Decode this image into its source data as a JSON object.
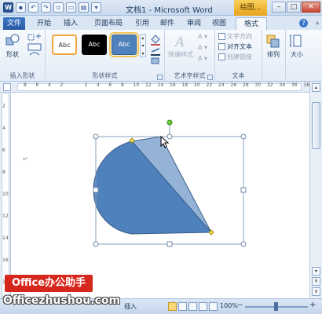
{
  "app": {
    "window_title": "文档1 - Microsoft Word",
    "context_tab_title": "绘图...",
    "window_buttons": {
      "minimize": "–",
      "maximize": "□",
      "close": "✕"
    }
  },
  "tabs": [
    "文件",
    "开始",
    "插入",
    "页面布局",
    "引用",
    "邮件",
    "审阅",
    "视图",
    "格式"
  ],
  "ribbon": {
    "groups": {
      "insert_shape": {
        "label": "插入形状",
        "shape_button": "形状"
      },
      "shape_styles": {
        "label": "形状样式",
        "samples": [
          "Abc",
          "Abc",
          "Abc"
        ]
      },
      "wordart_styles": {
        "label": "艺术字样式",
        "quick_styles": "快速样式"
      },
      "text": {
        "label": "文本",
        "text_direction": "文字方向",
        "align_text": "对齐文本",
        "create_link": "创建链接"
      },
      "arrange": {
        "arrange": "排列"
      },
      "size": {
        "size": "大小"
      }
    }
  },
  "ruler": {
    "ticks": [
      "8",
      "6",
      "4",
      "2",
      "",
      "2",
      "4",
      "6",
      "8",
      "10",
      "12",
      "14",
      "16",
      "18",
      "20",
      "22",
      "24",
      "26",
      "28",
      "30",
      "32",
      "34",
      "36",
      "38"
    ]
  },
  "vruler": {
    "ticks": [
      "2",
      "4",
      "6",
      "8",
      "10",
      "12",
      "14",
      "16",
      "18"
    ]
  },
  "statusbar": {
    "mode": "插入",
    "zoom": "100%"
  },
  "watermark": {
    "brand": "Office办公助手",
    "site": "Officezhushou.com"
  },
  "colors": {
    "shape_fill": "#4f81bd",
    "shape_light": "#95b3d7",
    "accent_ribbon": "#2b5797"
  }
}
